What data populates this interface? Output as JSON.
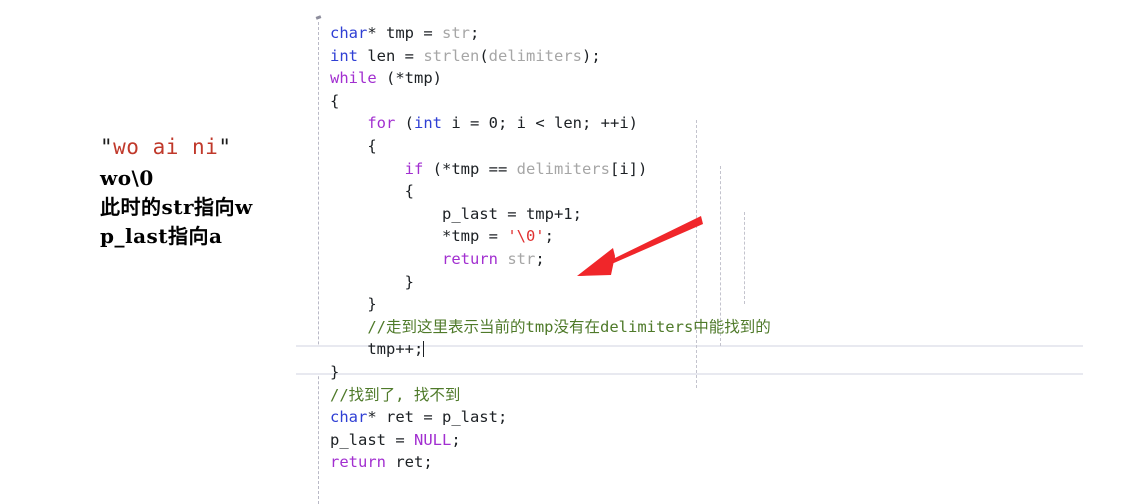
{
  "annotation": {
    "quote_open": "\"",
    "quote_text": "wo ai ni",
    "quote_close": "\"",
    "line_wo_null": "wo\\0",
    "line_str_points": "此时的str指向w",
    "line_plast_points": "p_last指向a"
  },
  "colors": {
    "keyword_blue": "#2f3fd4",
    "keyword_purple": "#a22fd0",
    "identifier_gray": "#a6a6a6",
    "string_red": "#e03131",
    "comment_green": "#4f7a2a",
    "plain_text": "#1c2024",
    "arrow_red": "#f0262a",
    "annotation_red": "#c0392b",
    "current_line_band": "#e8e9f0",
    "indent_guide": "#c3c3cd"
  },
  "code": {
    "lines": [
      [
        {
          "t": "char",
          "c": "kw-blue"
        },
        {
          "t": "* ",
          "c": "plain"
        },
        {
          "t": "tmp",
          "c": "plain"
        },
        {
          "t": " = ",
          "c": "plain"
        },
        {
          "t": "str",
          "c": "ident-gray"
        },
        {
          "t": ";",
          "c": "plain"
        }
      ],
      [
        {
          "t": "int",
          "c": "kw-blue"
        },
        {
          "t": " len = ",
          "c": "plain"
        },
        {
          "t": "strlen",
          "c": "ident-gray"
        },
        {
          "t": "(",
          "c": "plain"
        },
        {
          "t": "delimiters",
          "c": "ident-gray"
        },
        {
          "t": ");",
          "c": "plain"
        }
      ],
      [
        {
          "t": "while",
          "c": "kw-purple"
        },
        {
          "t": " (*tmp)",
          "c": "plain"
        }
      ],
      [
        {
          "t": "{",
          "c": "brace"
        }
      ],
      [
        {
          "t": "    ",
          "c": "plain"
        },
        {
          "t": "for",
          "c": "kw-purple"
        },
        {
          "t": " (",
          "c": "plain"
        },
        {
          "t": "int",
          "c": "kw-blue"
        },
        {
          "t": " i = 0; i ",
          "c": "plain"
        },
        {
          "t": "<",
          "c": "plain"
        },
        {
          "t": " len; ++i)",
          "c": "plain"
        }
      ],
      [
        {
          "t": "    {",
          "c": "brace"
        }
      ],
      [
        {
          "t": "        ",
          "c": "plain"
        },
        {
          "t": "if",
          "c": "kw-purple"
        },
        {
          "t": " (*tmp == ",
          "c": "plain"
        },
        {
          "t": "delimiters",
          "c": "ident-gray"
        },
        {
          "t": "[i])",
          "c": "plain"
        }
      ],
      [
        {
          "t": "        {",
          "c": "brace"
        }
      ],
      [
        {
          "t": "            p_last = tmp+1;",
          "c": "plain"
        }
      ],
      [
        {
          "t": "            *tmp = ",
          "c": "plain"
        },
        {
          "t": "'\\0'",
          "c": "str-red"
        },
        {
          "t": ";",
          "c": "plain"
        }
      ],
      [
        {
          "t": "            ",
          "c": "plain"
        },
        {
          "t": "return",
          "c": "kw-purple"
        },
        {
          "t": " ",
          "c": "plain"
        },
        {
          "t": "str",
          "c": "ident-gray"
        },
        {
          "t": ";",
          "c": "plain"
        }
      ],
      [
        {
          "t": "        }",
          "c": "brace"
        }
      ],
      [
        {
          "t": "    }",
          "c": "brace"
        }
      ],
      [
        {
          "t": "    //走到这里表示当前的tmp没有在delimiters中能找到的",
          "c": "comment-gn"
        }
      ],
      [
        {
          "t": "    tmp++;",
          "c": "plain"
        }
      ],
      [
        {
          "t": "}",
          "c": "brace"
        }
      ],
      [
        {
          "t": "//找到了, 找不到",
          "c": "comment-gn"
        }
      ],
      [
        {
          "t": "char",
          "c": "kw-blue"
        },
        {
          "t": "* ret = p_last;",
          "c": "plain"
        }
      ],
      [
        {
          "t": "p_last = ",
          "c": "plain"
        },
        {
          "t": "NULL",
          "c": "kw-purple"
        },
        {
          "t": ";",
          "c": "plain"
        }
      ],
      [
        {
          "t": "return",
          "c": "kw-purple"
        },
        {
          "t": " ret;",
          "c": "plain"
        }
      ]
    ],
    "caret_line_index": 14
  }
}
